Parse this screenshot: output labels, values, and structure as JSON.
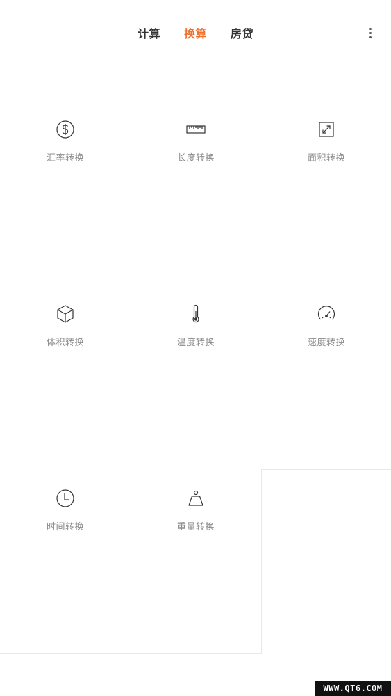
{
  "header": {
    "tabs": [
      {
        "label": "计算",
        "active": false
      },
      {
        "label": "换算",
        "active": true
      },
      {
        "label": "房贷",
        "active": false
      }
    ],
    "menu_icon": "more-vertical-icon"
  },
  "colors": {
    "accent": "#f0702e",
    "tab_text": "#333333",
    "label_text": "#8c8c8c",
    "icon_stroke": "#333333",
    "background": "#ffffff"
  },
  "converters": [
    {
      "label": "汇率转换",
      "icon": "dollar-icon"
    },
    {
      "label": "长度转换",
      "icon": "ruler-icon"
    },
    {
      "label": "面积转换",
      "icon": "expand-square-icon"
    },
    {
      "label": "体积转换",
      "icon": "cube-icon"
    },
    {
      "label": "温度转换",
      "icon": "thermometer-icon"
    },
    {
      "label": "速度转换",
      "icon": "speedometer-icon"
    },
    {
      "label": "时间转换",
      "icon": "clock-icon"
    },
    {
      "label": "重量转换",
      "icon": "weight-icon"
    }
  ],
  "watermark": "WWW.QT6.COM"
}
